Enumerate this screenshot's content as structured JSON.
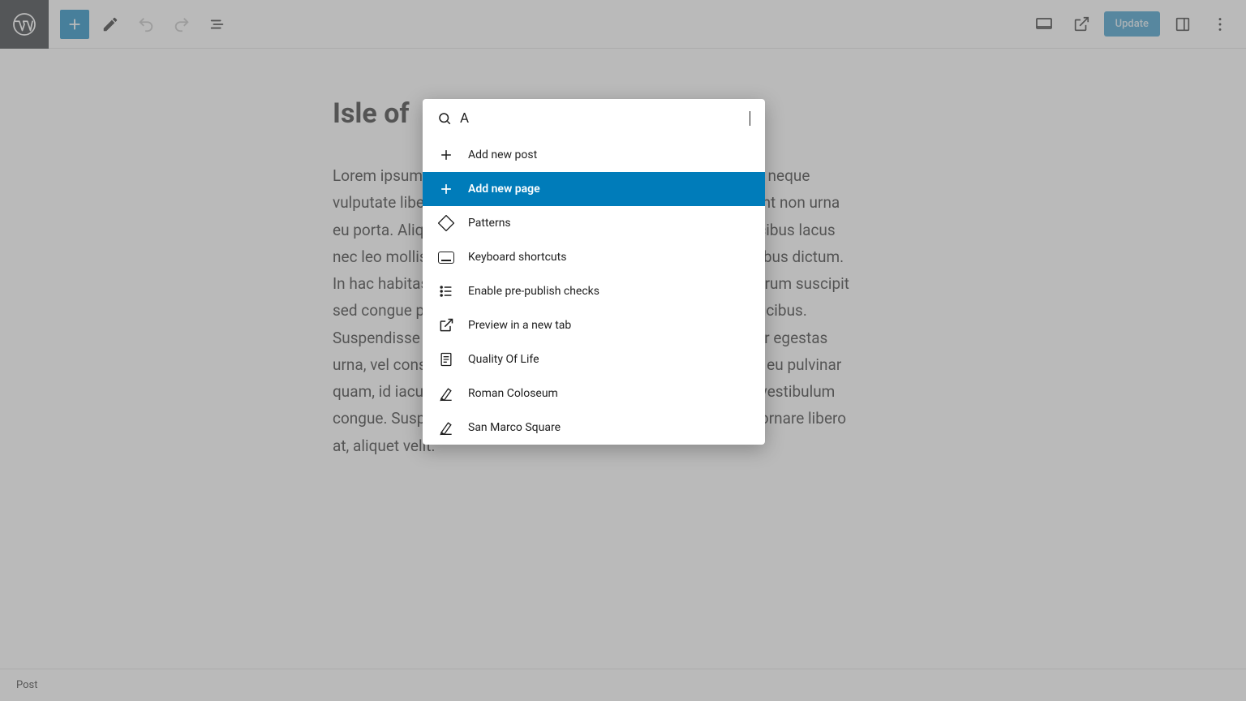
{
  "toolbar": {
    "update_label": "Update"
  },
  "editor": {
    "title": "Isle of",
    "body": "Lorem ipsum dolor sit amet, consectetur adipiscing elit. Integer neque vulputate libero et velit interdum, ac aliquet odio mattis. Praesent non urna eu porta. Aliquam erat volutpat. Curabitur euismod, nisi vel faucibus lacus nec leo mollis, ornare neque. Sed lectus enim, elementum faucibus dictum. In hac habitasse platea dictumst. Nulla facilisi. Vivamus nisi rutrum suscipit sed congue pharetra mi nec eleifend. Pellentesque primis in faucibus. Suspendisse potenti. Curabitur euismod, nisi vel dapibus a dolor egestas urna, vel consectetur enim. Pellentesque consectetur enim nisl, eu pulvinar quam, id iaculis nunc rutrum, nunc. Vestibulum dapibus purus, vestibulum congue. Suspendisse potenti. Sed lectus. Integer orci egestas, ornare libero at, aliquet velit."
  },
  "palette": {
    "search_value": "A",
    "items": [
      {
        "label": "Add new post",
        "icon": "plus-icon",
        "selected": false
      },
      {
        "label": "Add new page",
        "icon": "plus-icon",
        "selected": true
      },
      {
        "label": "Patterns",
        "icon": "patterns-icon",
        "selected": false
      },
      {
        "label": "Keyboard shortcuts",
        "icon": "keyboard-icon",
        "selected": false
      },
      {
        "label": "Enable pre-publish checks",
        "icon": "checklist-icon",
        "selected": false
      },
      {
        "label": "Preview in a new tab",
        "icon": "external-icon",
        "selected": false
      },
      {
        "label": "Quality Of Life",
        "icon": "page-icon",
        "selected": false
      },
      {
        "label": "Roman Coloseum",
        "icon": "post-icon",
        "selected": false
      },
      {
        "label": "San Marco Square",
        "icon": "post-icon",
        "selected": false
      }
    ]
  },
  "statusbar": {
    "breadcrumb": "Post"
  }
}
